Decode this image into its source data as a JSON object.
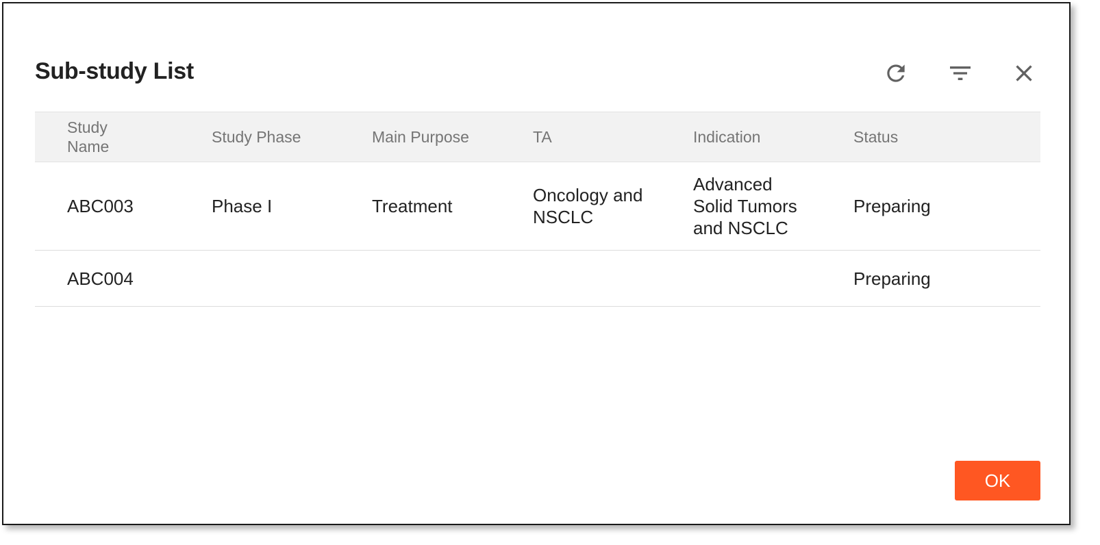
{
  "dialog": {
    "title": "Sub-study List",
    "ok_label": "OK",
    "accent_color": "#ff5722"
  },
  "actions": {
    "refresh_icon": "refresh-icon",
    "filter_icon": "filter-icon",
    "close_icon": "close-icon"
  },
  "table": {
    "columns": [
      "Study Name",
      "Study Phase",
      "Main Purpose",
      "TA",
      "Indication",
      "Status"
    ],
    "rows": [
      [
        "ABC003",
        "Phase I",
        "Treatment",
        "Oncology and NSCLC",
        "Advanced Solid Tumors and NSCLC",
        "Preparing"
      ],
      [
        "ABC004",
        "",
        "",
        "",
        "",
        "Preparing"
      ]
    ]
  }
}
